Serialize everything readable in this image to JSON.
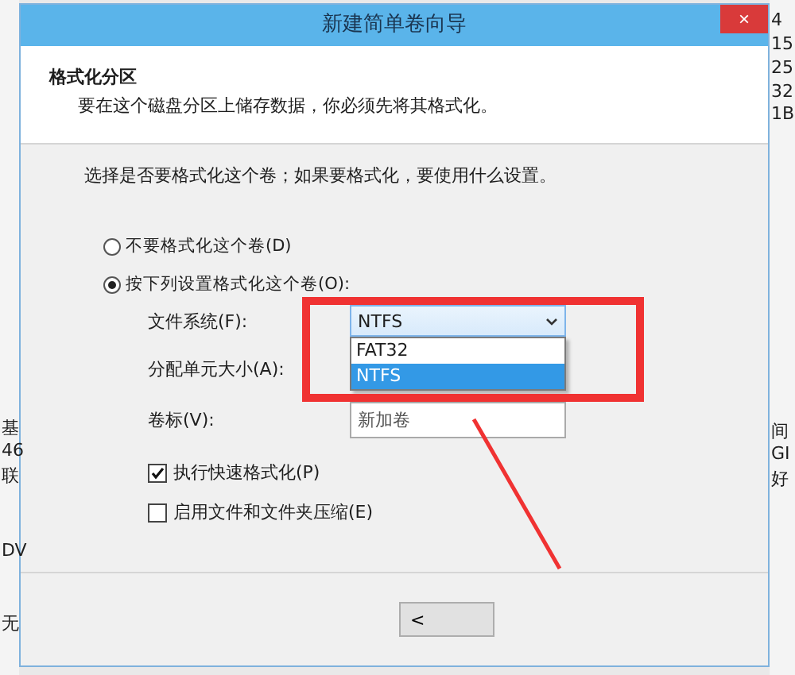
{
  "background_window": {
    "left_fragments": [
      "基",
      "46",
      "联",
      "DV",
      "无"
    ],
    "right_fragments": [
      "4",
      "15",
      "25",
      "32",
      "1B",
      "间",
      "GI",
      "好"
    ]
  },
  "dialog": {
    "title": "新建简单卷向导",
    "close_button": "×",
    "header": {
      "title": "格式化分区",
      "subtitle": "要在这个磁盘分区上储存数据，你必须先将其格式化。"
    },
    "prompt": "选择是否要格式化这个卷；如果要格式化，要使用什么设置。",
    "options": [
      {
        "label": "不要格式化这个卷(D)",
        "selected": false
      },
      {
        "label": "按下列设置格式化这个卷(O):",
        "selected": true
      }
    ],
    "settings": {
      "file_system": {
        "label": "文件系统(F):",
        "value": "NTFS",
        "expanded": true,
        "options": [
          {
            "label": "FAT32",
            "selected": false
          },
          {
            "label": "NTFS",
            "selected": true
          }
        ]
      },
      "allocation_unit": {
        "label": "分配单元大小(A):"
      },
      "volume_label": {
        "label": "卷标(V):",
        "value": "新加卷"
      }
    },
    "checkboxes": [
      {
        "label": "执行快速格式化(P)",
        "checked": true
      },
      {
        "label": "启用文件和文件夹压缩(E)",
        "checked": false
      }
    ],
    "buttons": [
      "<"
    ]
  }
}
